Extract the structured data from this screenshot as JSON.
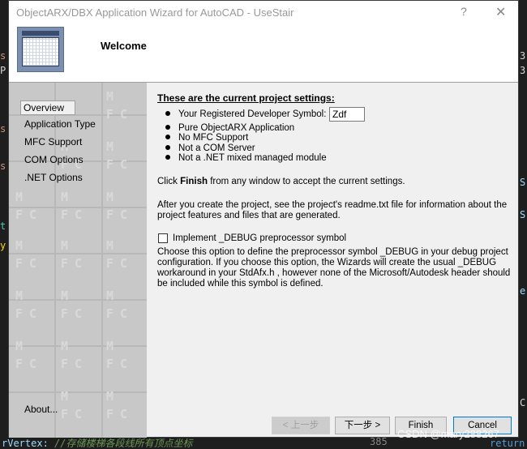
{
  "window": {
    "title": "ObjectARX/DBX Application Wizard for AutoCAD - UseStair",
    "help_label": "?",
    "close_label": "✕"
  },
  "header": {
    "title": "Welcome",
    "logo_icon": "wizard-window-icon"
  },
  "nav": {
    "items": [
      {
        "label": "Overview",
        "active": true
      },
      {
        "label": "Application Type"
      },
      {
        "label": "MFC Support"
      },
      {
        "label": "COM Options"
      },
      {
        "label": ".NET Options"
      }
    ],
    "about_label": "About..."
  },
  "content": {
    "settings_title": "These are the current project settings:",
    "developer_symbol_label": "Your Registered Developer Symbol:",
    "developer_symbol_value": "Zdf",
    "bullets": [
      "Pure ObjectARX Application",
      "No MFC Support",
      "Not a COM Server",
      "Not a .NET mixed managed module"
    ],
    "finish_prefix": "Click ",
    "finish_bold": "Finish",
    "finish_suffix": " from any window to accept the current settings.",
    "readme_text": "After you create the project, see the project's readme.txt file for information about the project features and files that are generated.",
    "debug_checkbox_label": "Implement _DEBUG preprocessor symbol",
    "debug_checked": false,
    "debug_description": "Choose this option to define the preprocessor symbol _DEBUG in your debug project configuration. If you choose this option, the Wizards will create the usual _DEBUG workaround in your StdAfx.h , however none of the Microsoft/Autodesk header should be included while this symbol is defined."
  },
  "buttons": {
    "back": "< 上一步",
    "next": "下一步 >",
    "finish": "Finish",
    "cancel": "Cancel"
  },
  "background": {
    "code_line": "rVertex:",
    "code_comment": "//存储楼梯各段线所有顶点坐标",
    "line_number": "385",
    "return_kw": "return",
    "watermark": "CSDN @mary288267"
  },
  "colors": {
    "accent": "#0078d7",
    "panel": "#c8c8c8",
    "dialog_bg": "#f0f0f0"
  }
}
